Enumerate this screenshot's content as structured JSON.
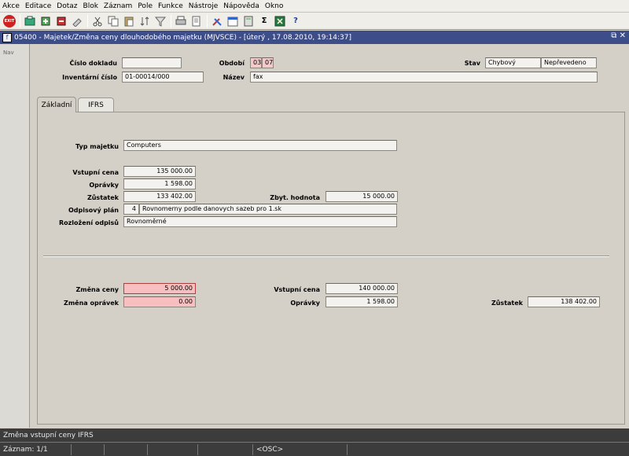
{
  "menu": [
    "Akce",
    "Editace",
    "Dotaz",
    "Blok",
    "Záznam",
    "Pole",
    "Funkce",
    "Nástroje",
    "Nápověda",
    "Okno"
  ],
  "toolbar": {
    "exit_label": "EXIT",
    "icons": [
      "save-icon",
      "insert-record-icon",
      "delete-record-icon",
      "clear-icon",
      "cut-icon",
      "copy-icon",
      "paste-icon",
      "sort-icon",
      "filter-icon",
      "print-icon",
      "edit-icon",
      "tools-icon",
      "calendar-icon",
      "calculator-icon",
      "sum-icon",
      "excel-icon",
      "help-icon"
    ]
  },
  "window": {
    "title": "05400 - Majetek/Změna ceny dlouhodobého majetku (MJVSCE) - [úterý  , 17.08.2010, 19:14:37]",
    "controls": "⧉ ✕"
  },
  "nav": {
    "label": "Nav"
  },
  "header": {
    "cislo_dokladu_label": "Číslo dokladu",
    "cislo_dokladu_value": "",
    "obdobi_label": "Období",
    "obdobi_month": "03",
    "obdobi_year": "07",
    "stav_label": "Stav",
    "stav_value1": "Chybový",
    "stav_value2": "Nepřevedeno",
    "inventarni_cislo_label": "Inventární číslo",
    "inventarni_cislo_value": "01-00014/000",
    "nazev_label": "Název",
    "nazev_value": "fax"
  },
  "tabs": [
    {
      "label": "Základní",
      "active": true
    },
    {
      "label": "IFRS",
      "active": false
    }
  ],
  "basic": {
    "typ_majetku_label": "Typ majetku",
    "typ_majetku_value": "Computers",
    "vstupni_cena_label": "Vstupní cena",
    "vstupni_cena_value": "135 000.00",
    "opravky_label": "Oprávky",
    "opravky_value": "1 598.00",
    "zustatek_label": "Zůstatek",
    "zustatek_value": "133 402.00",
    "zbyt_hodnota_label": "Zbyt. hodnota",
    "zbyt_hodnota_value": "15 000.00",
    "odpisovy_plan_label": "Odpisový plán",
    "odpisovy_plan_code": "4",
    "odpisovy_plan_value": "Rovnomerny podle danovych sazeb pro 1.sk",
    "rozlozeni_label": "Rozložení odpisů",
    "rozlozeni_value": "Rovnoměrné"
  },
  "change": {
    "zmena_ceny_label": "Změna ceny",
    "zmena_ceny_value": "5 000.00",
    "zmena_opravek_label": "Změna oprávek",
    "zmena_opravek_value": "0.00",
    "vstupni_cena_label": "Vstupní cena",
    "vstupni_cena_value": "140 000.00",
    "opravky_label": "Oprávky",
    "opravky_value": "1 598.00",
    "zustatek_label": "Zůstatek",
    "zustatek_value": "138 402.00"
  },
  "hint": "Změna vstupní ceny IFRS",
  "status": {
    "record": "Záznam: 1/1",
    "mode": "<OSC>"
  },
  "colors": {
    "title_bg": "#3d4d89",
    "required_bg": "#f7bfbf",
    "status_bg": "#3c3c3c"
  }
}
